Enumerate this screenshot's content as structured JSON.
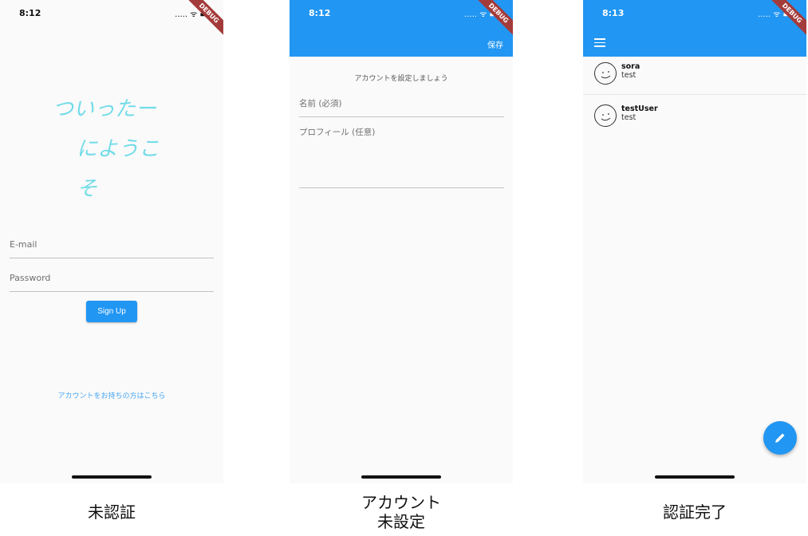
{
  "screen1": {
    "time": "8:12",
    "status_icons": "..... ᯤ ▬",
    "debug": "DEBUG",
    "welcome_line1": "ついったー",
    "welcome_line2": "にようこそ",
    "email_placeholder": "E-mail",
    "password_placeholder": "Password",
    "signup_label": "Sign Up",
    "account_link": "アカウントをお持ちの方はこちら",
    "caption": "未認証"
  },
  "screen2": {
    "time": "8:12",
    "status_icons": "..... ᯤ ▬",
    "debug": "DEBUG",
    "save_label": "保存",
    "title": "アカウントを設定しましょう",
    "name_placeholder": "名前 (必須)",
    "profile_placeholder": "プロフィール (任意)",
    "caption_line1": "アカウント",
    "caption_line2": "未設定"
  },
  "screen3": {
    "time": "8:13",
    "status_icons": "..... ᯤ ▬",
    "debug": "DEBUG",
    "users": [
      {
        "name": "sora",
        "bio": "test"
      },
      {
        "name": "testUser",
        "bio": "test"
      }
    ],
    "caption": "認証完了"
  },
  "colors": {
    "primary": "#2196f3",
    "welcome": "#72dce8",
    "link": "#45a6f3"
  }
}
